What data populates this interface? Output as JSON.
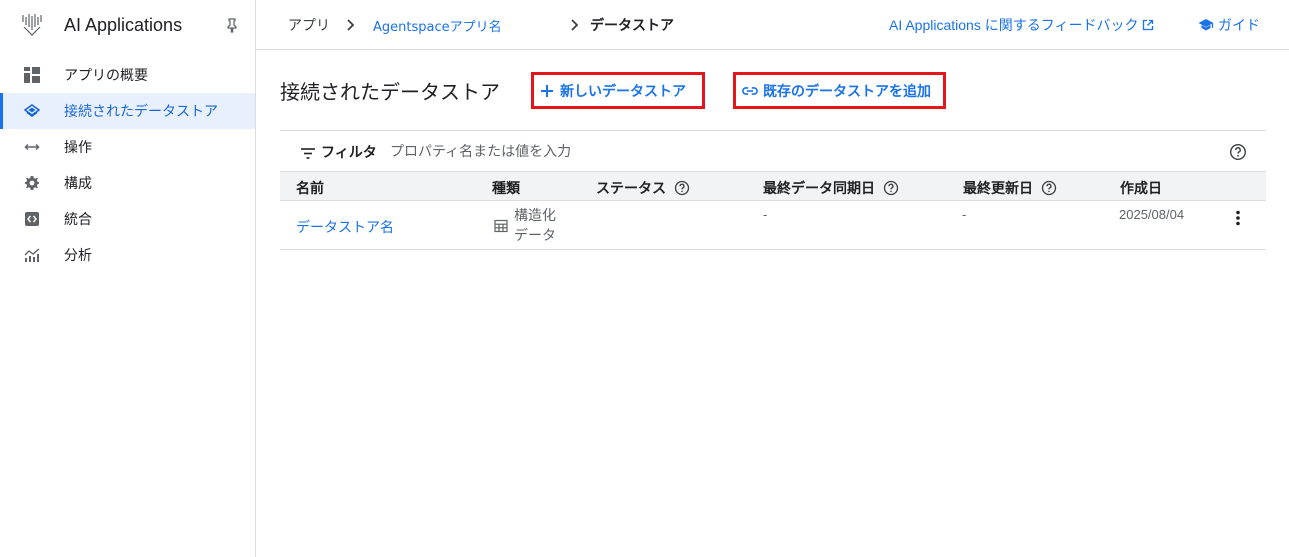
{
  "app": {
    "title": "AI Applications"
  },
  "sidebar": {
    "items": [
      {
        "label": "アプリの概要",
        "icon": "dashboard-icon"
      },
      {
        "label": "接続されたデータストア",
        "icon": "layers-icon",
        "active": true
      },
      {
        "label": "操作",
        "icon": "arrows-icon"
      },
      {
        "label": "構成",
        "icon": "gear-icon"
      },
      {
        "label": "統合",
        "icon": "code-icon"
      },
      {
        "label": "分析",
        "icon": "analytics-icon"
      }
    ]
  },
  "header": {
    "breadcrumb": [
      "アプリ",
      "Agentspaceアプリ名",
      "データストア"
    ],
    "feedback_label": "AI Applications に関するフィードバック",
    "guide_label": "ガイド"
  },
  "main": {
    "title": "接続されたデータストア",
    "new_datastore_label": "新しいデータストア",
    "add_existing_label": "既存のデータストアを追加",
    "filter": {
      "label": "フィルタ",
      "placeholder": "プロパティ名または値を入力"
    },
    "table": {
      "columns": [
        "名前",
        "種類",
        "ステータス",
        "最終データ同期日",
        "最終更新日",
        "作成日"
      ],
      "rows": [
        {
          "name": "データストア名",
          "type": "構造化データ",
          "status": "",
          "last_sync": "-",
          "last_updated": "-",
          "created": "2025/08/04"
        }
      ]
    }
  },
  "colors": {
    "accent": "#1a73e8",
    "highlight_border": "#e4161b",
    "active_bg": "#e8f0fe"
  }
}
